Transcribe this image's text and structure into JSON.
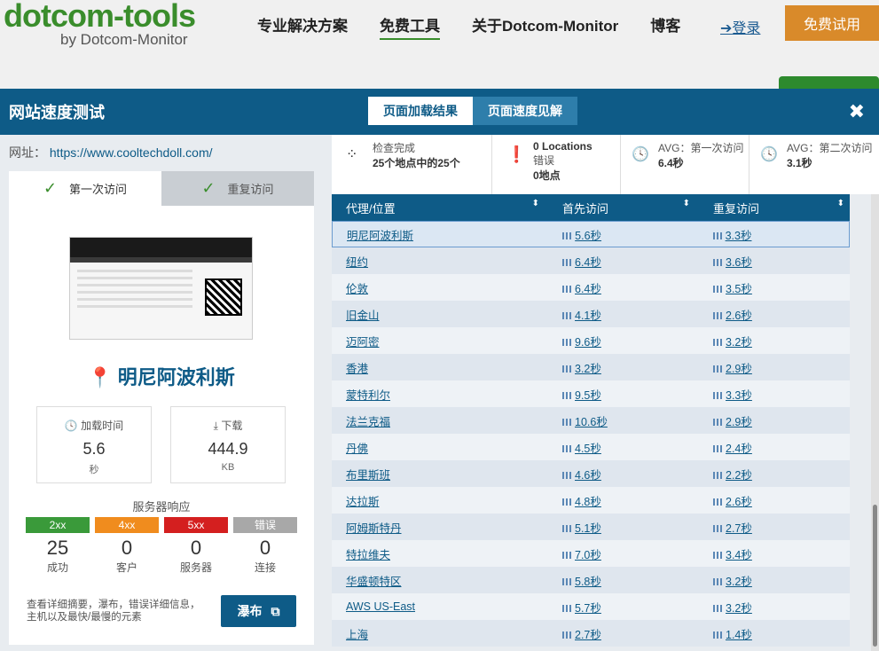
{
  "site": {
    "logo_main": "dotcom-tools",
    "logo_sub": "by Dotcom-Monitor",
    "nav": [
      "专业解决方案",
      "免费工具",
      "关于Dotcom-Monitor",
      "博客"
    ],
    "login": "登录",
    "trial": "免费试用"
  },
  "modal": {
    "title": "网站速度测试",
    "tabs": [
      "页面加载结果",
      "页面速度见解"
    ],
    "close": "✖"
  },
  "left": {
    "url_label": "网址：",
    "url": "https://www.cooltechdoll.com/",
    "visit_tabs": [
      "第一次访问",
      "重复访问"
    ],
    "location": "明尼阿波利斯",
    "load_time": {
      "label": "加载时间",
      "value": "5.6",
      "unit": "秒"
    },
    "download": {
      "label": "下载",
      "value": "444.9",
      "unit": "KB"
    },
    "server_response_title": "服务器响应",
    "responses": [
      {
        "code": "2xx",
        "count": "25",
        "caption": "成功",
        "color": "#3a9a3a"
      },
      {
        "code": "4xx",
        "count": "0",
        "caption": "客户",
        "color": "#f08c1e"
      },
      {
        "code": "5xx",
        "count": "0",
        "caption": "服务器",
        "color": "#d41f1f"
      },
      {
        "code": "错误",
        "count": "0",
        "caption": "连接",
        "color": "#a8a8a8"
      }
    ],
    "footer_text": "查看详细摘要，瀑布，错误详细信息，主机以及最快/最慢的元素",
    "waterfall_button": "瀑布"
  },
  "summary": {
    "check": {
      "t1": "检查完成",
      "t2": "25个地点中的25个"
    },
    "errors": {
      "t1": "0 Locations",
      "t2": "错误",
      "t3": "0地点"
    },
    "avg_first": {
      "t1": "AVG：第一次访问",
      "t2": "6.4秒"
    },
    "avg_repeat": {
      "t1": "AVG：第二次访问",
      "t2": "3.1秒"
    }
  },
  "table": {
    "headers": [
      "代理/位置",
      "首先访问",
      "重复访问"
    ],
    "rows": [
      {
        "loc": "明尼阿波利斯",
        "first": "5.6秒",
        "repeat": "3.3秒"
      },
      {
        "loc": "纽约",
        "first": "6.4秒",
        "repeat": "3.6秒"
      },
      {
        "loc": "伦敦",
        "first": "6.4秒",
        "repeat": "3.5秒"
      },
      {
        "loc": "旧金山",
        "first": "4.1秒",
        "repeat": "2.6秒"
      },
      {
        "loc": "迈阿密",
        "first": "9.6秒",
        "repeat": "3.2秒"
      },
      {
        "loc": "香港",
        "first": "3.2秒",
        "repeat": "2.9秒"
      },
      {
        "loc": "蒙特利尔",
        "first": "9.5秒",
        "repeat": "3.3秒"
      },
      {
        "loc": "法兰克福",
        "first": "10.6秒",
        "repeat": "2.9秒"
      },
      {
        "loc": "丹佛",
        "first": "4.5秒",
        "repeat": "2.4秒"
      },
      {
        "loc": "布里斯班",
        "first": "4.6秒",
        "repeat": "2.2秒"
      },
      {
        "loc": "达拉斯",
        "first": "4.8秒",
        "repeat": "2.6秒"
      },
      {
        "loc": "阿姆斯特丹",
        "first": "5.1秒",
        "repeat": "2.7秒"
      },
      {
        "loc": "特拉维夫",
        "first": "7.0秒",
        "repeat": "3.4秒"
      },
      {
        "loc": "华盛顿特区",
        "first": "5.8秒",
        "repeat": "3.2秒"
      },
      {
        "loc": "AWS US-East",
        "first": "5.7秒",
        "repeat": "3.2秒"
      },
      {
        "loc": "上海",
        "first": "2.7秒",
        "repeat": "1.4秒"
      }
    ]
  }
}
